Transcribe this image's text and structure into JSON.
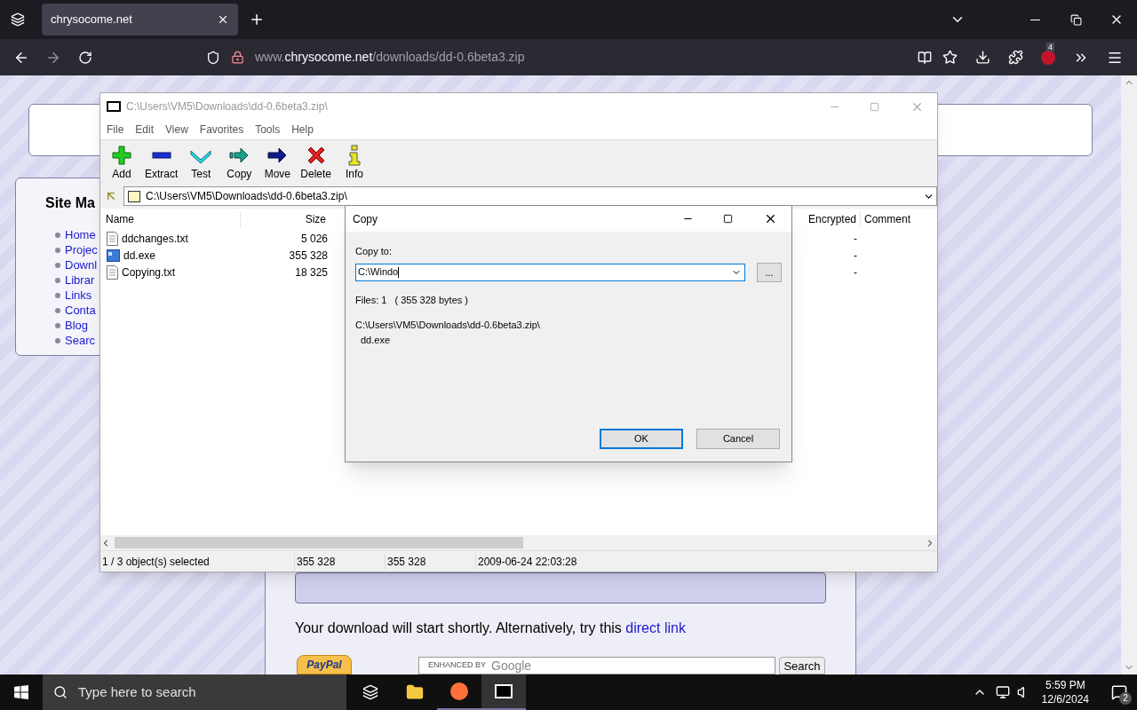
{
  "browser": {
    "tab": {
      "title": "chrysocome.net"
    },
    "url": {
      "prefix": "www.",
      "domain": "chrysocome.net",
      "path": "/downloads/dd-0.6beta3.zip"
    },
    "extension_badge": "4"
  },
  "page": {
    "site_map": {
      "title": "Site Ma",
      "items": [
        "Home",
        "Projec",
        "Downl",
        "Librar",
        "Links",
        "Conta",
        "Blog",
        "Searc"
      ]
    },
    "download_note": {
      "text": "Your download will start shortly. Alternatively, try this",
      "link": "direct link"
    },
    "paypal": {
      "label": "PayPal"
    },
    "google_search": {
      "prefix": "ENHANCED BY",
      "brand": "Google",
      "button": "Search"
    }
  },
  "archive_window": {
    "title": "C:\\Users\\VM5\\Downloads\\dd-0.6beta3.zip\\",
    "menu": [
      "File",
      "Edit",
      "View",
      "Favorites",
      "Tools",
      "Help"
    ],
    "toolbar": [
      {
        "label": "Add",
        "kind": "add"
      },
      {
        "label": "Extract",
        "kind": "extract"
      },
      {
        "label": "Test",
        "kind": "test"
      },
      {
        "label": "Copy",
        "kind": "copy"
      },
      {
        "label": "Move",
        "kind": "move"
      },
      {
        "label": "Delete",
        "kind": "delete"
      },
      {
        "label": "Info",
        "kind": "info"
      }
    ],
    "address": "C:\\Users\\VM5\\Downloads\\dd-0.6beta3.zip\\",
    "columns": {
      "name": "Name",
      "size": "Size",
      "encrypted": "Encrypted",
      "comment": "Comment"
    },
    "rows": [
      {
        "name": "ddchanges.txt",
        "kind": "text",
        "size": "5 026",
        "encrypted": "-"
      },
      {
        "name": "dd.exe",
        "kind": "program",
        "size": "355 328",
        "encrypted": "-"
      },
      {
        "name": "Copying.txt",
        "kind": "text",
        "size": "18 325",
        "encrypted": "-"
      }
    ],
    "status": [
      "1 / 3 object(s) selected",
      "355 328",
      "355 328",
      "2009-06-24 22:03:28"
    ]
  },
  "copy_dialog": {
    "title": "Copy",
    "label": "Copy to:",
    "value": "C:\\Windo",
    "browse": "...",
    "files": "Files: 1",
    "bytes": "( 355 328 bytes )",
    "source": "C:\\Users\\VM5\\Downloads\\dd-0.6beta3.zip\\",
    "file": "dd.exe",
    "ok": "OK",
    "cancel": "Cancel"
  },
  "taskbar": {
    "search_placeholder": "Type here to search",
    "time": "5:59 PM",
    "date": "12/6/2024",
    "notifications": "2"
  }
}
